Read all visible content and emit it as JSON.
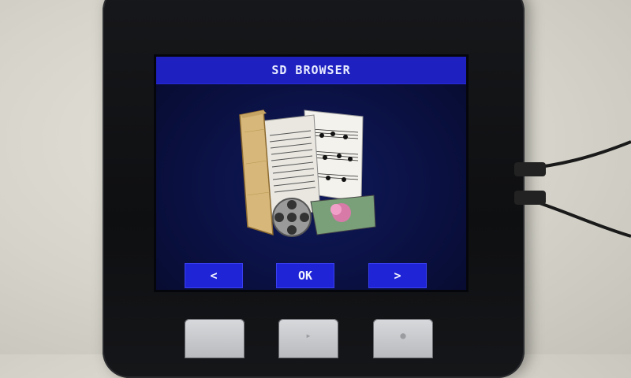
{
  "screen": {
    "title": "SD BROWSER"
  },
  "buttons": {
    "prev_label": "<",
    "ok_label": "OK",
    "next_label": ">"
  },
  "icons": {
    "main": "folder-media-icon",
    "prev": "chevron-left-icon",
    "next": "chevron-right-icon"
  },
  "colors": {
    "title_bar": "#1e20c0",
    "button": "#1f25d6",
    "screen_bg": "#0a1040",
    "text": "#e8ecff"
  }
}
